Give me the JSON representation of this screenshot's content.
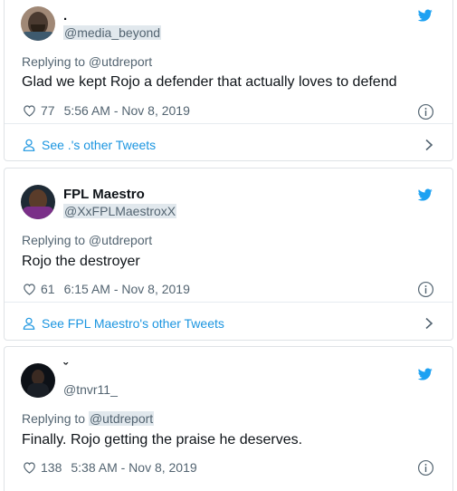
{
  "tweets": [
    {
      "display_name": ".",
      "handle": "@media_beyond",
      "replying_to": "Replying to @utdreport",
      "text": "Glad we kept Rojo a defender that actually loves to defend",
      "likes": "77",
      "timestamp": "5:56 AM - Nov 8, 2019",
      "other_tweets": "See .'s other Tweets"
    },
    {
      "display_name": "FPL Maestro",
      "handle": "@XxFPLMaestroxX",
      "replying_to": "Replying to @utdreport",
      "text": "Rojo the destroyer",
      "likes": "61",
      "timestamp": "6:15 AM - Nov 8, 2019",
      "other_tweets": "See FPL Maestro's other Tweets"
    },
    {
      "display_name": "ˇ",
      "handle": "@tnvr11_",
      "replying_to_prefix": "Replying to ",
      "replying_to_user": "@utdreport",
      "text": "Finally. Rojo getting the praise he deserves.",
      "likes": "138",
      "timestamp": "5:38 AM - Nov 8, 2019"
    }
  ],
  "colors": {
    "accent": "#1b95e0",
    "twitter_blue": "#1da1f2",
    "muted": "#536471",
    "border": "#dfe3e6"
  },
  "icons": [
    "twitter-bird-icon",
    "heart-icon",
    "info-icon",
    "person-icon",
    "chevron-right-icon"
  ]
}
